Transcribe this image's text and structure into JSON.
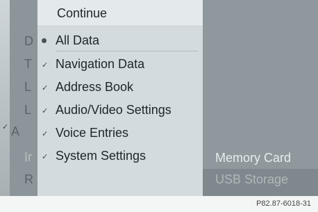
{
  "menu": {
    "title": "Continue",
    "items": [
      {
        "label": "All Data",
        "icon": "radio-bullet-icon",
        "selected": true
      },
      {
        "label": "Navigation Data",
        "icon": "checkmark-icon"
      },
      {
        "label": "Address Book",
        "icon": "checkmark-icon"
      },
      {
        "label": "Audio/Video Settings",
        "icon": "checkmark-icon"
      },
      {
        "label": "Voice Entries",
        "icon": "checkmark-icon"
      },
      {
        "label": "System Settings",
        "icon": "checkmark-icon"
      }
    ]
  },
  "background": {
    "letters": [
      "D",
      "T",
      "L",
      "L",
      "A",
      "Ir",
      "R"
    ],
    "right_options": [
      "Memory Card",
      "USB Storage"
    ]
  },
  "figure_ref": "P82.87-6018-31"
}
